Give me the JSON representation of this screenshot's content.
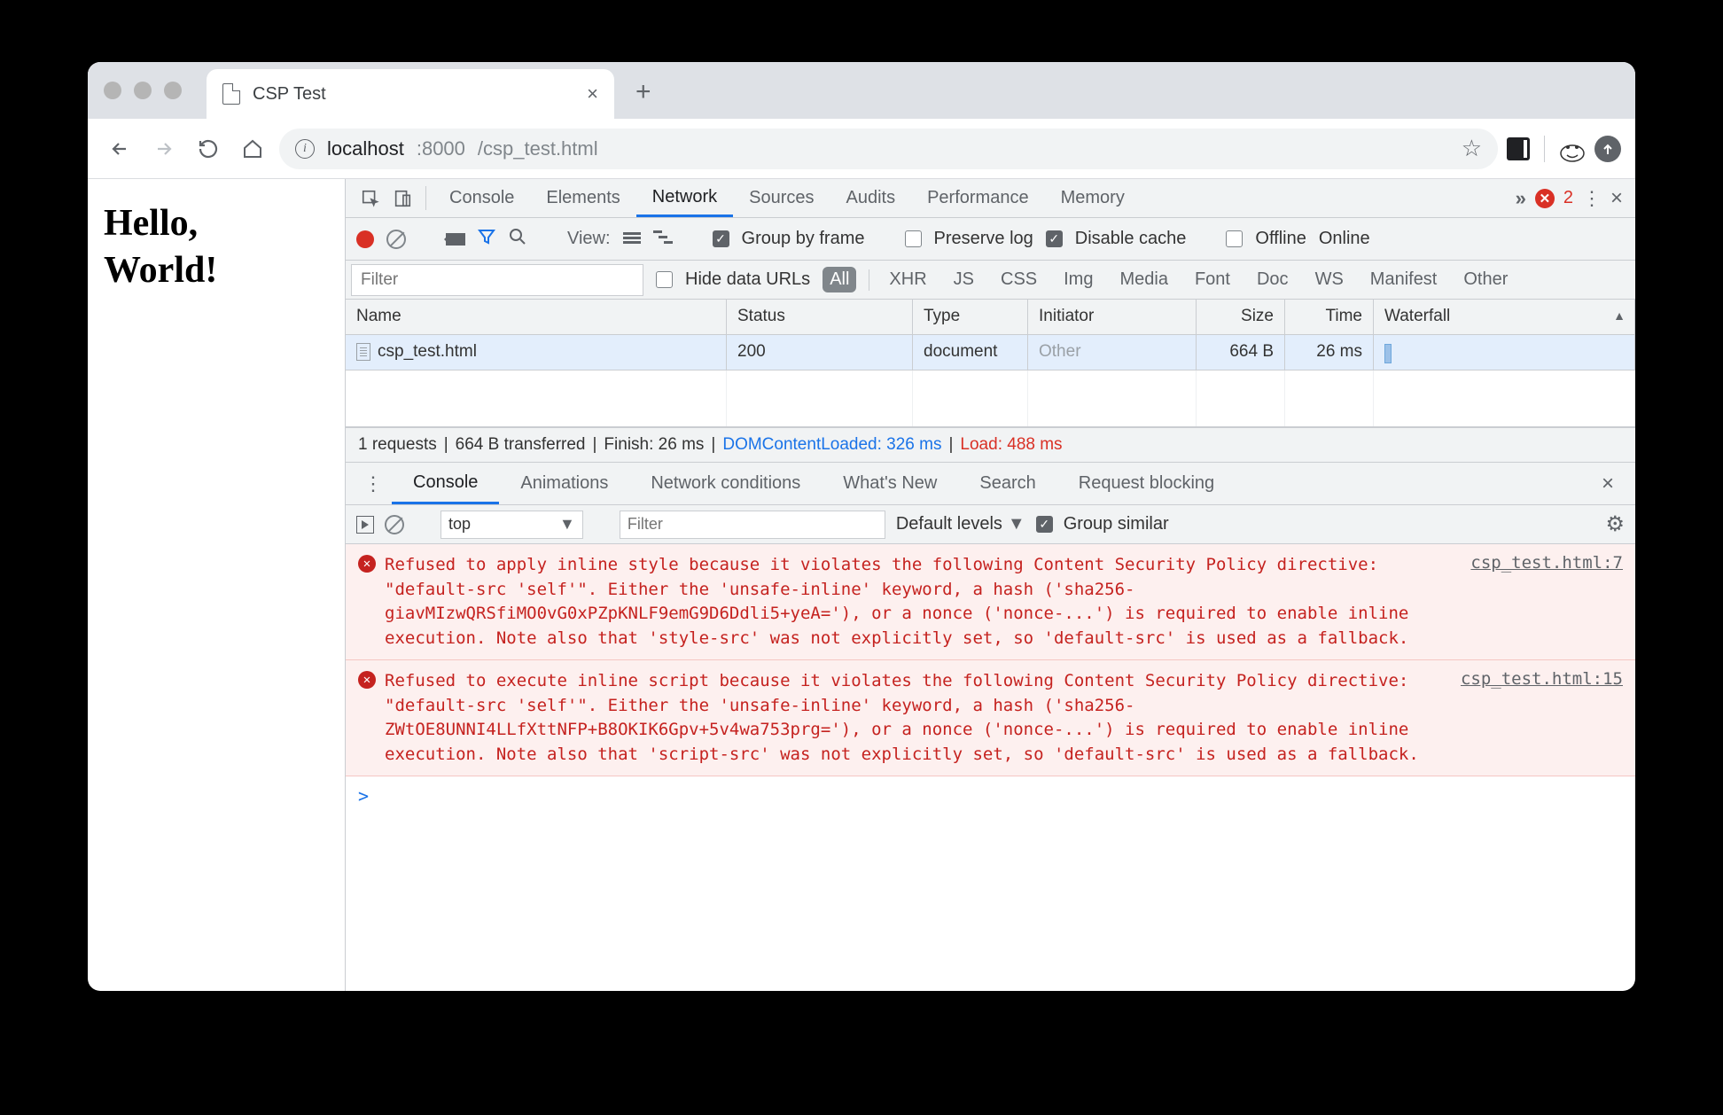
{
  "browser": {
    "tab_title": "CSP Test",
    "url_host": "localhost",
    "url_port": ":8000",
    "url_path": "/csp_test.html"
  },
  "page": {
    "line1": "Hello,",
    "line2": "World!"
  },
  "devtools": {
    "panels": [
      "Console",
      "Elements",
      "Network",
      "Sources",
      "Audits",
      "Performance",
      "Memory"
    ],
    "active_panel": "Network",
    "error_count": "2"
  },
  "net_toolbar": {
    "view_label": "View:",
    "group_by_frame": "Group by frame",
    "preserve_log": "Preserve log",
    "disable_cache": "Disable cache",
    "offline": "Offline",
    "online": "Online"
  },
  "filterbar": {
    "filter_placeholder": "Filter",
    "hide_data_urls": "Hide data URLs",
    "chips": [
      "All",
      "XHR",
      "JS",
      "CSS",
      "Img",
      "Media",
      "Font",
      "Doc",
      "WS",
      "Manifest",
      "Other"
    ]
  },
  "net_cols": [
    "Name",
    "Status",
    "Type",
    "Initiator",
    "Size",
    "Time",
    "Waterfall"
  ],
  "net_row": {
    "name": "csp_test.html",
    "status": "200",
    "type": "document",
    "initiator": "Other",
    "size": "664 B",
    "time": "26 ms"
  },
  "net_status": {
    "requests": "1 requests",
    "transferred": "664 B transferred",
    "finish": "Finish: 26 ms",
    "dcl": "DOMContentLoaded: 326 ms",
    "load": "Load: 488 ms"
  },
  "drawer": {
    "tabs": [
      "Console",
      "Animations",
      "Network conditions",
      "What's New",
      "Search",
      "Request blocking"
    ],
    "active": "Console"
  },
  "console_toolbar": {
    "context": "top",
    "filter_placeholder": "Filter",
    "levels": "Default levels",
    "group_similar": "Group similar"
  },
  "console_messages": [
    {
      "text": "Refused to apply inline style because it violates the following Content Security Policy directive: \"default-src 'self'\". Either the 'unsafe-inline' keyword, a hash ('sha256-giavMIzwQRSfiMO0vG0xPZpKNLF9emG9D6Ddli5+yeA='), or a nonce ('nonce-...') is required to enable inline execution. Note also that 'style-src' was not explicitly set, so 'default-src' is used as a fallback.",
      "source": "csp_test.html:7"
    },
    {
      "text": "Refused to execute inline script because it violates the following Content Security Policy directive: \"default-src 'self'\". Either the 'unsafe-inline' keyword, a hash ('sha256-ZWtOE8UNNI4LLfXttNFP+B8OKIK6Gpv+5v4wa753prg='), or a nonce ('nonce-...') is required to enable inline execution. Note also that 'script-src' was not explicitly set, so 'default-src' is used as a fallback.",
      "source": "csp_test.html:15"
    }
  ],
  "prompt": ">"
}
